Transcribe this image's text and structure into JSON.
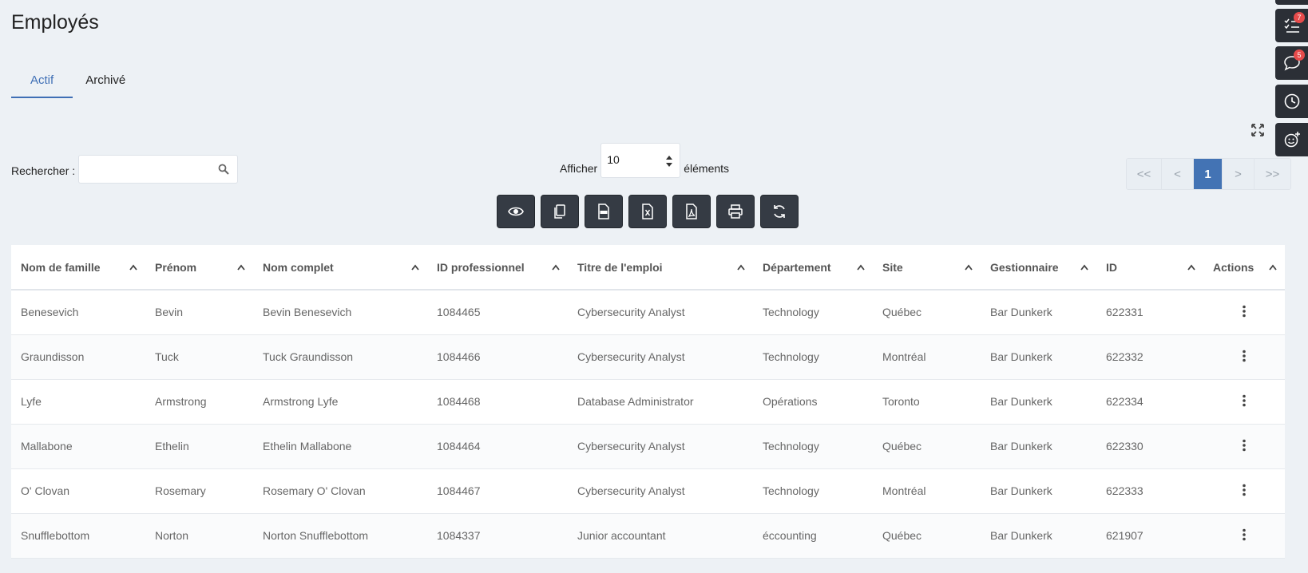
{
  "page": {
    "title": "Employés"
  },
  "tabs": [
    {
      "label": "Actif",
      "active": true
    },
    {
      "label": "Archivé",
      "active": false
    }
  ],
  "search": {
    "label": "Rechercher :",
    "value": "",
    "placeholder": ""
  },
  "length": {
    "before": "Afficher",
    "value": "10",
    "after": "éléments"
  },
  "toolbar": [
    "eye-icon",
    "copy-icon",
    "csv-icon",
    "excel-icon",
    "pdf-icon",
    "print-icon",
    "refresh-icon"
  ],
  "pagination": {
    "first": "<<",
    "prev": "<",
    "current": "1",
    "next": ">",
    "last": ">>"
  },
  "sidebar": {
    "tasks_badge": "7",
    "messages_badge": "5"
  },
  "colors": {
    "accent": "#4373b4",
    "dark": "#353b44",
    "badge": "#e64b4b",
    "background": "#edf1f5"
  },
  "table": {
    "columns": [
      "Nom de famille",
      "Prénom",
      "Nom complet",
      "ID professionnel",
      "Titre de l'emploi",
      "Département",
      "Site",
      "Gestionnaire",
      "ID",
      "Actions"
    ],
    "rows": [
      [
        "Benesevich",
        "Bevin",
        "Bevin Benesevich",
        "1084465",
        "Cybersecurity Analyst",
        "Technology",
        "Québec",
        "Bar Dunkerk",
        "622331"
      ],
      [
        "Graundisson",
        "Tuck",
        "Tuck Graundisson",
        "1084466",
        "Cybersecurity Analyst",
        "Technology",
        "Montréal",
        "Bar Dunkerk",
        "622332"
      ],
      [
        "Lyfe",
        "Armstrong",
        "Armstrong Lyfe",
        "1084468",
        "Database Administrator",
        "Opérations",
        "Toronto",
        "Bar Dunkerk",
        "622334"
      ],
      [
        "Mallabone",
        "Ethelin",
        "Ethelin Mallabone",
        "1084464",
        "Cybersecurity Analyst",
        "Technology",
        "Québec",
        "Bar Dunkerk",
        "622330"
      ],
      [
        "O' Clovan",
        "Rosemary",
        "Rosemary O' Clovan",
        "1084467",
        "Cybersecurity Analyst",
        "Technology",
        "Montréal",
        "Bar Dunkerk",
        "622333"
      ],
      [
        "Snufflebottom",
        "Norton",
        "Norton Snufflebottom",
        "1084337",
        "Junior accountant",
        "éccounting",
        "Québec",
        "Bar Dunkerk",
        "621907"
      ]
    ]
  }
}
